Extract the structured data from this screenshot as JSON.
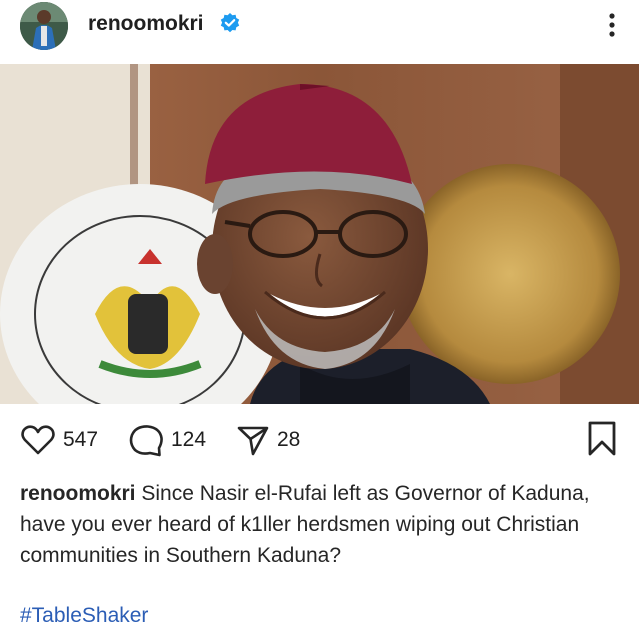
{
  "post": {
    "username": "renoomokri",
    "verified_color": "#1d9bf0",
    "caption_user": "renoomokri",
    "caption_text": " Since Nasir el-Rufai left as Governor of Kaduna, have you ever heard of k1ller herdsmen wiping out Christian communities in Southern Kaduna?",
    "hashtag": "#TableShaker"
  },
  "stats": {
    "likes": "547",
    "comments": "124",
    "shares": "28"
  },
  "icons": {
    "avatar": "avatar",
    "verified": "verified-badge-icon",
    "more": "more-options-icon",
    "like": "heart-icon",
    "comment": "comment-bubble-icon",
    "share": "paper-plane-icon",
    "save": "bookmark-icon"
  },
  "colors": {
    "text": "#262626",
    "hashtag": "#2b5db5",
    "background": "#ffffff"
  }
}
